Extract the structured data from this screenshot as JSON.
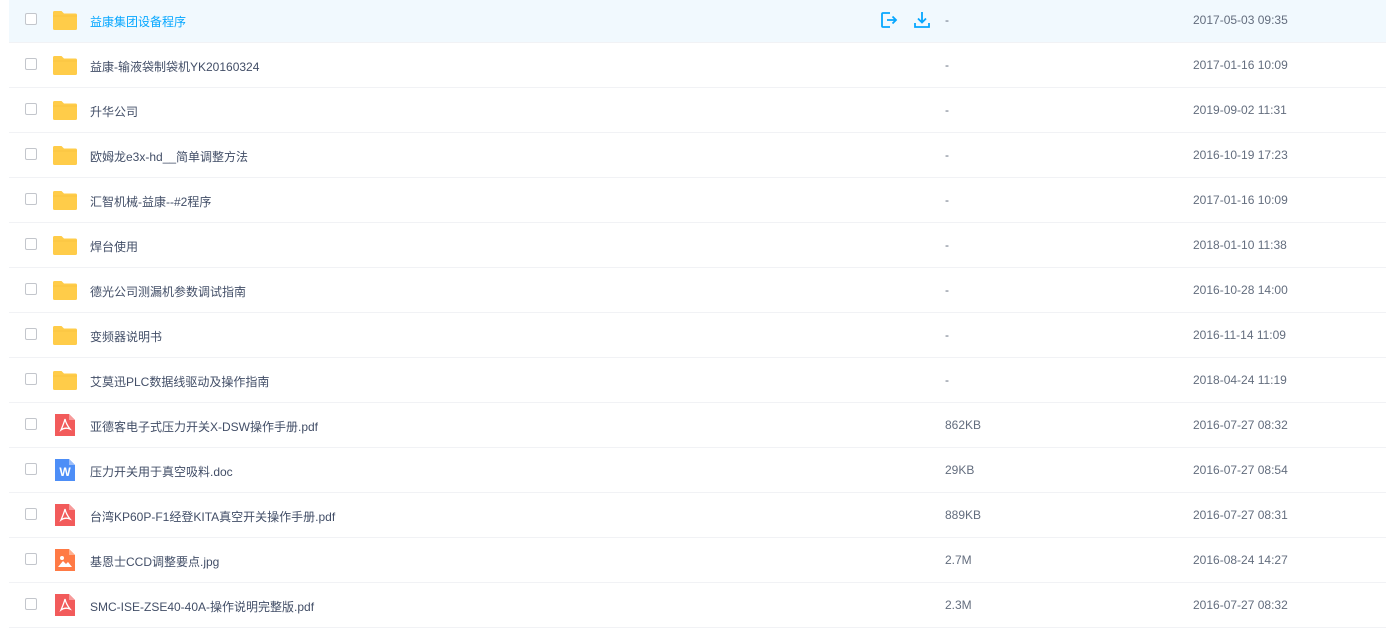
{
  "colors": {
    "accent": "#06a7ff",
    "folder": "#ffcc49",
    "pdf": "#f25b5b",
    "doc": "#4d8ef7",
    "img": "#ff7a45"
  },
  "actions": {
    "share": "share-icon",
    "download": "download-icon"
  },
  "files": [
    {
      "name": "益康集团设备程序",
      "size": "-",
      "date": "2017-05-03 09:35",
      "type": "folder"
    },
    {
      "name": "益康-输液袋制袋机YK20160324",
      "size": "-",
      "date": "2017-01-16 10:09",
      "type": "folder"
    },
    {
      "name": "升华公司",
      "size": "-",
      "date": "2019-09-02 11:31",
      "type": "folder"
    },
    {
      "name": "欧姆龙e3x-hd__简单调整方法",
      "size": "-",
      "date": "2016-10-19 17:23",
      "type": "folder"
    },
    {
      "name": "汇智机械-益康--#2程序",
      "size": "-",
      "date": "2017-01-16 10:09",
      "type": "folder"
    },
    {
      "name": "焊台使用",
      "size": "-",
      "date": "2018-01-10 11:38",
      "type": "folder"
    },
    {
      "name": "德光公司测漏机参数调试指南",
      "size": "-",
      "date": "2016-10-28 14:00",
      "type": "folder"
    },
    {
      "name": "变频器说明书",
      "size": "-",
      "date": "2016-11-14 11:09",
      "type": "folder"
    },
    {
      "name": "艾莫迅PLC数据线驱动及操作指南",
      "size": "-",
      "date": "2018-04-24 11:19",
      "type": "folder"
    },
    {
      "name": "亚德客电子式压力开关X-DSW操作手册.pdf",
      "size": "862KB",
      "date": "2016-07-27 08:32",
      "type": "pdf"
    },
    {
      "name": "压力开关用于真空吸料.doc",
      "size": "29KB",
      "date": "2016-07-27 08:54",
      "type": "doc"
    },
    {
      "name": "台湾KP60P-F1经登KITA真空开关操作手册.pdf",
      "size": "889KB",
      "date": "2016-07-27 08:31",
      "type": "pdf"
    },
    {
      "name": "基恩士CCD调整要点.jpg",
      "size": "2.7M",
      "date": "2016-08-24 14:27",
      "type": "img"
    },
    {
      "name": "SMC-ISE-ZSE40-40A-操作说明完整版.pdf",
      "size": "2.3M",
      "date": "2016-07-27 08:32",
      "type": "pdf"
    }
  ]
}
